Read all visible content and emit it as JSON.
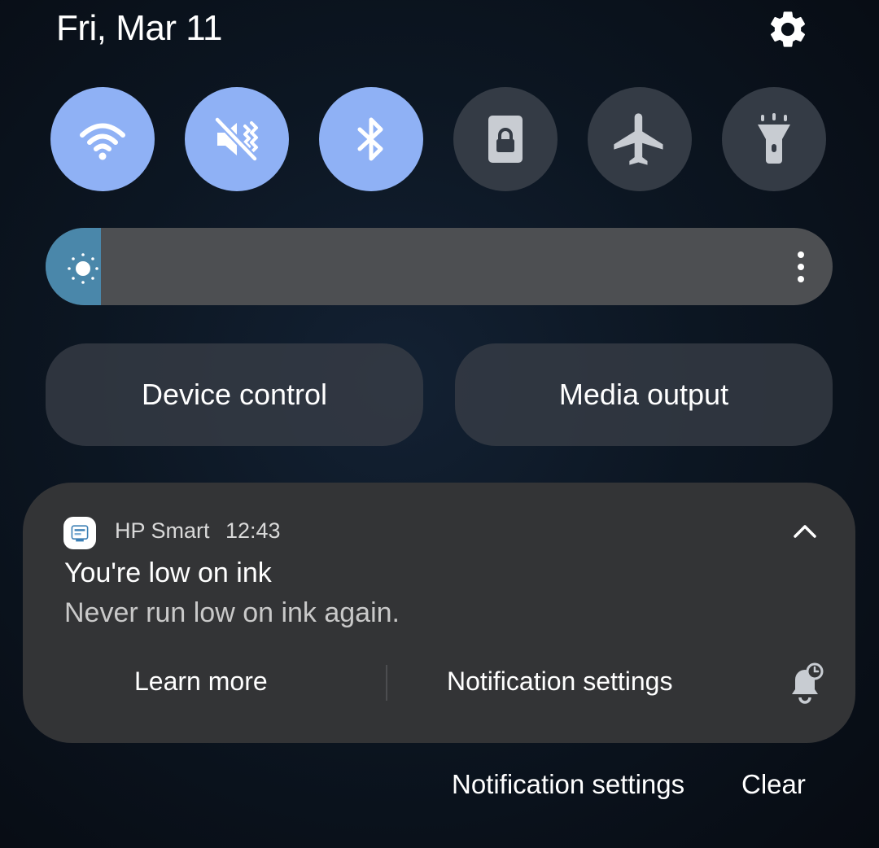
{
  "header": {
    "date": "Fri, Mar 11",
    "settings_icon": "gear-icon"
  },
  "quick_toggles": [
    {
      "name": "wifi",
      "icon": "wifi-icon",
      "state": "on"
    },
    {
      "name": "sound",
      "icon": "vibrate-mute-icon",
      "state": "on"
    },
    {
      "name": "bluetooth",
      "icon": "bluetooth-icon",
      "state": "on"
    },
    {
      "name": "portrait-lock",
      "icon": "portrait-lock-icon",
      "state": "off"
    },
    {
      "name": "airplane-mode",
      "icon": "airplane-icon",
      "state": "off"
    },
    {
      "name": "flashlight",
      "icon": "flashlight-icon",
      "state": "off"
    }
  ],
  "brightness": {
    "level": 0.07,
    "icon": "sun-icon",
    "more_icon": "more-vertical-icon"
  },
  "panel_buttons": {
    "device_control": "Device control",
    "media_output": "Media output"
  },
  "notification": {
    "app_name": "HP Smart",
    "time": "12:43",
    "title": "You're low on ink",
    "body": "Never run low on ink again.",
    "actions": {
      "learn_more": "Learn more",
      "settings": "Notification settings"
    },
    "snooze_icon": "bell-snooze-icon",
    "collapse_icon": "chevron-up-icon"
  },
  "footer": {
    "notification_settings": "Notification settings",
    "clear": "Clear"
  },
  "colors": {
    "toggle_on": "#8fb1f5",
    "toggle_off": "#343b45",
    "brightness_fill": "#4a87aa",
    "card": "#333436"
  }
}
